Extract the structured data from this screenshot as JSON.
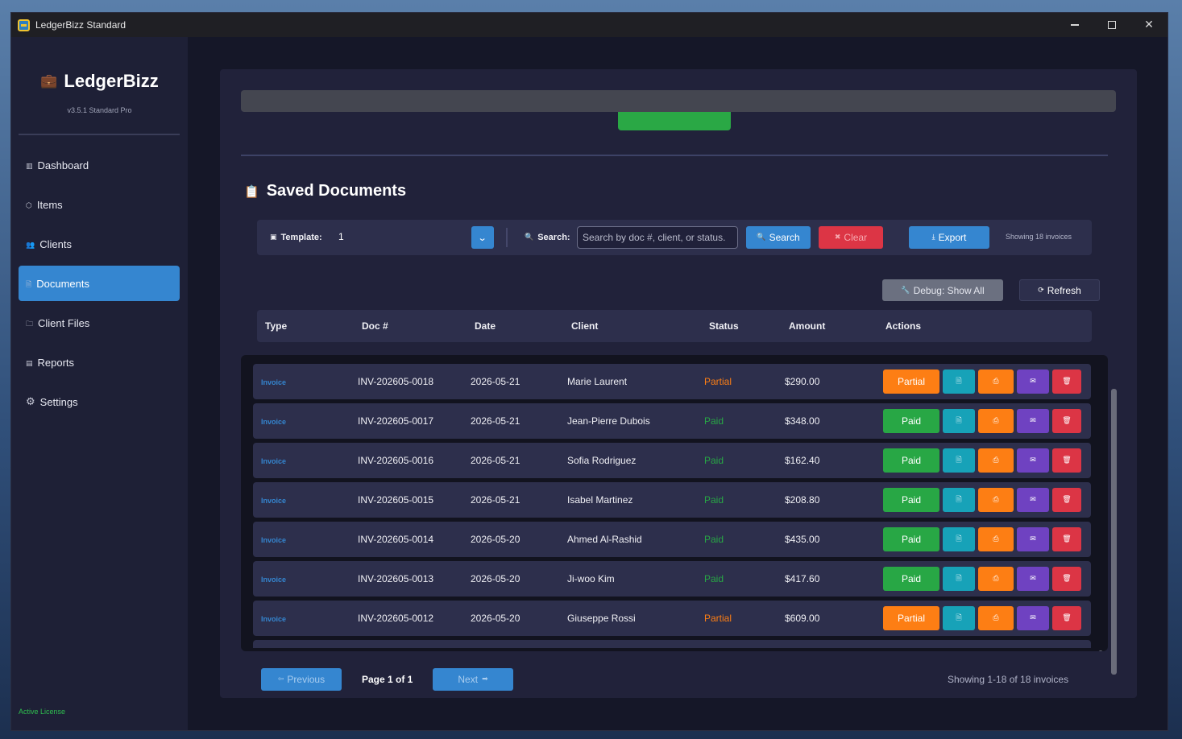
{
  "window": {
    "title": "LedgerBizz Standard"
  },
  "sidebar": {
    "brand": "LedgerBizz",
    "version": "v3.5.1 Standard Pro",
    "items": [
      {
        "label": "Dashboard",
        "icon": "dashboard-icon"
      },
      {
        "label": "Items",
        "icon": "items-icon"
      },
      {
        "label": "Clients",
        "icon": "clients-icon"
      },
      {
        "label": "Documents",
        "icon": "documents-icon"
      },
      {
        "label": "Client Files",
        "icon": "folder-icon"
      },
      {
        "label": "Reports",
        "icon": "reports-icon"
      },
      {
        "label": "Settings",
        "icon": "gear-icon"
      }
    ],
    "active_item": "Documents",
    "license": "Active License"
  },
  "main": {
    "section_title": "Saved Documents",
    "toolbar": {
      "template_label": "Template:",
      "template_value": "1",
      "search_label": "Search:",
      "search_placeholder": "Search by doc #, client, or status.",
      "search_value": "",
      "search_button": "Search",
      "clear_button": "Clear",
      "export_button": "Export",
      "showing_count": "Showing 18 invoices"
    },
    "debug_button": "Debug: Show All",
    "refresh_button": "Refresh",
    "columns": [
      "Type",
      "Doc #",
      "Date",
      "Client",
      "Status",
      "Amount",
      "Actions"
    ],
    "rows": [
      {
        "type": "Invoice",
        "doc": "INV-202605-0018",
        "date": "2026-05-21",
        "client": "Marie Laurent",
        "status": "Partial",
        "amount": "$290.00"
      },
      {
        "type": "Invoice",
        "doc": "INV-202605-0017",
        "date": "2026-05-21",
        "client": "Jean-Pierre Dubois",
        "status": "Paid",
        "amount": "$348.00"
      },
      {
        "type": "Invoice",
        "doc": "INV-202605-0016",
        "date": "2026-05-21",
        "client": "Sofia Rodriguez",
        "status": "Paid",
        "amount": "$162.40"
      },
      {
        "type": "Invoice",
        "doc": "INV-202605-0015",
        "date": "2026-05-21",
        "client": "Isabel Martinez",
        "status": "Paid",
        "amount": "$208.80"
      },
      {
        "type": "Invoice",
        "doc": "INV-202605-0014",
        "date": "2026-05-20",
        "client": "Ahmed Al-Rashid",
        "status": "Paid",
        "amount": "$435.00"
      },
      {
        "type": "Invoice",
        "doc": "INV-202605-0013",
        "date": "2026-05-20",
        "client": "Ji-woo Kim",
        "status": "Paid",
        "amount": "$417.60"
      },
      {
        "type": "Invoice",
        "doc": "INV-202605-0012",
        "date": "2026-05-20",
        "client": "Giuseppe Rossi",
        "status": "Partial",
        "amount": "$609.00"
      }
    ],
    "pagination": {
      "previous": "Previous",
      "next": "Next",
      "page_indicator": "Page 1 of 1",
      "showing": "Showing 1-18 of 18 invoices"
    }
  },
  "colors": {
    "accent_blue": "#3586d0",
    "paid_green": "#28a745",
    "partial_orange": "#fd7e14",
    "danger_red": "#dc3545",
    "email_purple": "#6f42c1",
    "view_teal": "#17a2b8"
  }
}
